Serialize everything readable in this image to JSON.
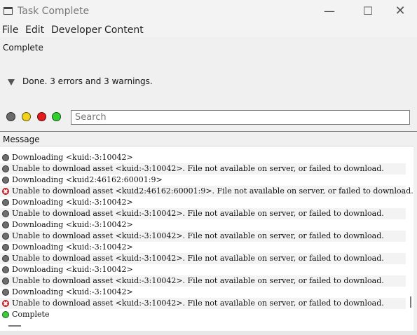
{
  "window": {
    "title": "Task Complete"
  },
  "menu": [
    "File",
    "Edit",
    "Developer",
    "Content"
  ],
  "status": {
    "label": "Complete",
    "summary": "Done. 3 errors and 3 warnings."
  },
  "filters": [
    {
      "name": "filter-grey",
      "color": "#6b6b6b"
    },
    {
      "name": "filter-yellow",
      "color": "#f2d21a"
    },
    {
      "name": "filter-red",
      "color": "#e21c1c"
    },
    {
      "name": "filter-green",
      "color": "#2fd02f"
    }
  ],
  "search": {
    "placeholder": "Search"
  },
  "list_header": "Message",
  "icon_colors": {
    "info": "#6f6f6f",
    "error": "#d9363e",
    "complete": "#3ecb3e"
  },
  "messages": [
    {
      "type": "info",
      "text": "Downloading <kuid:-3:10042>"
    },
    {
      "type": "info",
      "text": "Unable to download asset <kuid:-3:10042>. File not available on server, or failed to download."
    },
    {
      "type": "info",
      "text": "Downloading <kuid2:46162:60001:9>"
    },
    {
      "type": "error",
      "text": "Unable to download asset <kuid2:46162:60001:9>. File not available on server, or failed to download."
    },
    {
      "type": "info",
      "text": "Downloading <kuid:-3:10042>"
    },
    {
      "type": "info",
      "text": "Unable to download asset <kuid:-3:10042>. File not available on server, or failed to download."
    },
    {
      "type": "info",
      "text": "Downloading <kuid:-3:10042>"
    },
    {
      "type": "info",
      "text": "Unable to download asset <kuid:-3:10042>. File not available on server, or failed to download."
    },
    {
      "type": "info",
      "text": "Downloading <kuid:-3:10042>"
    },
    {
      "type": "info",
      "text": "Unable to download asset <kuid:-3:10042>. File not available on server, or failed to download."
    },
    {
      "type": "info",
      "text": "Downloading <kuid:-3:10042>"
    },
    {
      "type": "info",
      "text": "Unable to download asset <kuid:-3:10042>. File not available on server, or failed to download."
    },
    {
      "type": "info",
      "text": "Downloading <kuid:-3:10042>"
    },
    {
      "type": "error",
      "text": "Unable to download asset <kuid:-3:10042>. File not available on server, or failed to download."
    },
    {
      "type": "complete",
      "text": "Complete"
    }
  ]
}
